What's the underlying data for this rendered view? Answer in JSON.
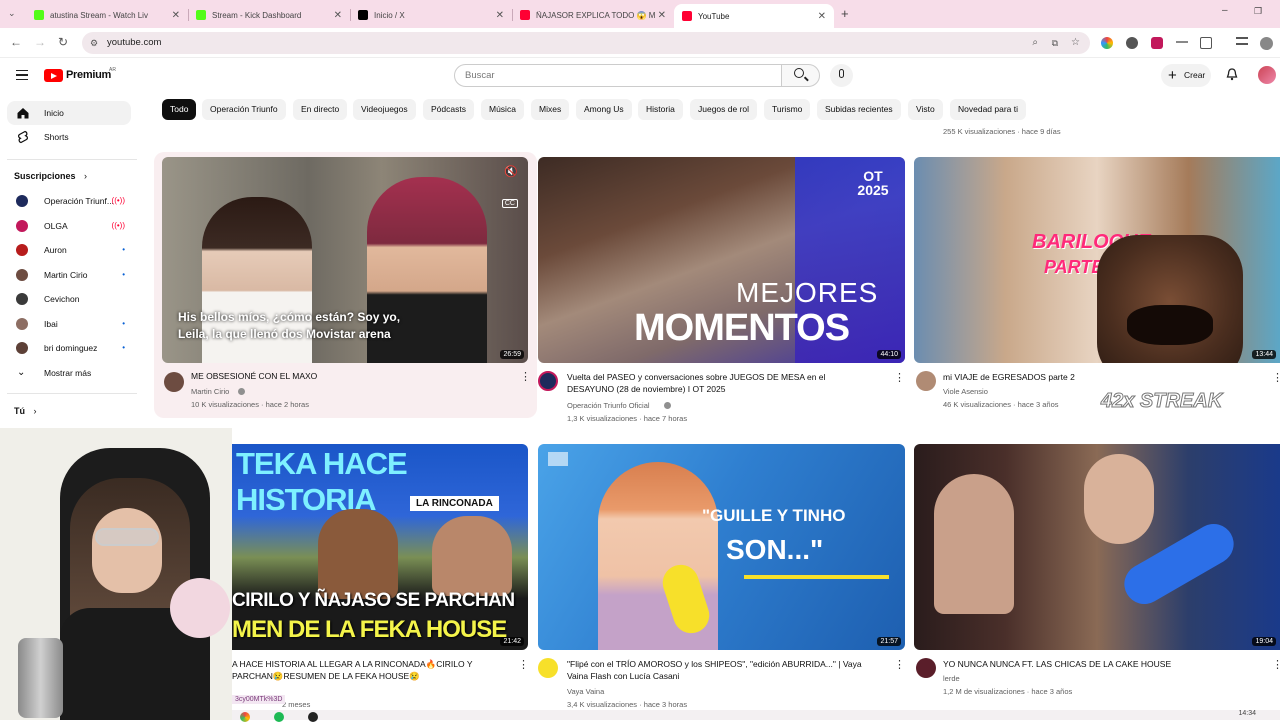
{
  "tabs": [
    {
      "title": "atustina Stream - Watch Liv",
      "fav": "#53fc18"
    },
    {
      "title": "Stream - Kick Dashboard",
      "fav": "#53fc18"
    },
    {
      "title": "Inicio / X",
      "fav": "#000000"
    },
    {
      "title": "ÑAJASOR EXPLICA TODO 😱 M",
      "fav": "#ff0033"
    },
    {
      "title": "YouTube",
      "fav": "#ff0033"
    }
  ],
  "address": "youtube.com",
  "header": {
    "brand": "Premium",
    "region": "AR",
    "search_placeholder": "Buscar",
    "create": "Crear"
  },
  "sidebar": {
    "main": [
      {
        "label": "Inicio"
      },
      {
        "label": "Shorts"
      }
    ],
    "subs_heading": "Suscripciones",
    "subs": [
      {
        "label": "Operación Triunf...",
        "live": "((•))",
        "color": "#1d2a5c"
      },
      {
        "label": "OLGA",
        "live": "((•))",
        "color": "#c2185b"
      },
      {
        "label": "Auron",
        "live": "•",
        "color": "#b71c1c"
      },
      {
        "label": "Martin Cirio",
        "live": "•",
        "color": "#6d4c41"
      },
      {
        "label": "Cevichon",
        "live": "",
        "color": "#3a3a3a"
      },
      {
        "label": "Ibai",
        "live": "•",
        "color": "#8d6e63"
      },
      {
        "label": "bri dominguez",
        "live": "•",
        "color": "#5d4037"
      }
    ],
    "show_more": "Mostrar más",
    "you": "Tú"
  },
  "chips": [
    "Todo",
    "Operación Triunfo",
    "En directo",
    "Videojuegos",
    "Pódcasts",
    "Música",
    "Mixes",
    "Among Us",
    "Historia",
    "Juegos de rol",
    "Turismo",
    "Subidas recientes",
    "Visto",
    "Novedad para ti"
  ],
  "top_meta": "255 K visualizaciones · hace 9 días",
  "videos": [
    {
      "title": "ME OBSESIONÉ CON EL MAXO",
      "channel": "Martin Cirio",
      "stats": "10 K visualizaciones · hace 2 horas",
      "duration": "26:59",
      "caption": "His bellos míos, ¿cómo están? Soy yo, Leila, la que llenó dos Movistar arena"
    },
    {
      "title": "Vuelta del PASEO y conversaciones sobre JUEGOS DE MESA en el DESAYUNO (28 de noviembre) I OT 2025",
      "channel": "Operación Triunfo Oficial",
      "stats": "1,3 K visualizaciones · hace 7 horas",
      "duration": "44:10",
      "overlay1": "MEJORES",
      "overlay2": "MOMENTOS",
      "badge": "OT 2025"
    },
    {
      "title": "mi VIAJE de EGRESADOS parte 2",
      "channel": "Viole Asensio",
      "stats": "46 K visualizaciones · hace 3 años",
      "duration": "13:44",
      "overlay1": "BARILOCHE",
      "overlay2": "PARTE 2"
    },
    {
      "title": "A HACE HISTORIA AL LLEGAR A LA RINCONADA🔥CIRILO Y PARCHAN😢RESUMEN DE LA FEKA HOUSE😢",
      "channel": "",
      "stats": "2 meses",
      "duration": "21:42",
      "overlay1": "TEKA HACE HISTORIA",
      "overlay2": "LA RINCONADA",
      "overlay3": "CIRILO Y ÑAJASO SE PARCHAN",
      "overlay4": "MEN DE LA FEKA HOUSE"
    },
    {
      "title": "\"Flipé con el TRÍO AMOROSO y los SHIPEOS\", \"edición ABURRIDA...\" | Vaya Vaina Flash con Lucía Casani",
      "channel": "Vaya Vaina",
      "stats": "3,4 K visualizaciones · hace 3 horas",
      "duration": "21:57",
      "overlay1": "\"GUILLE Y TINHO",
      "overlay2": "SON...\""
    },
    {
      "title": "YO NUNCA NUNCA FT. LAS CHICAS DE LA CAKE HOUSE",
      "channel": "lerde",
      "stats": "1,2 M de visualizaciones · hace 3 años",
      "duration": "19:04"
    }
  ],
  "streak": "42x STREAK",
  "clock": "14:34",
  "link_hint": "3cy00MTk%3D"
}
